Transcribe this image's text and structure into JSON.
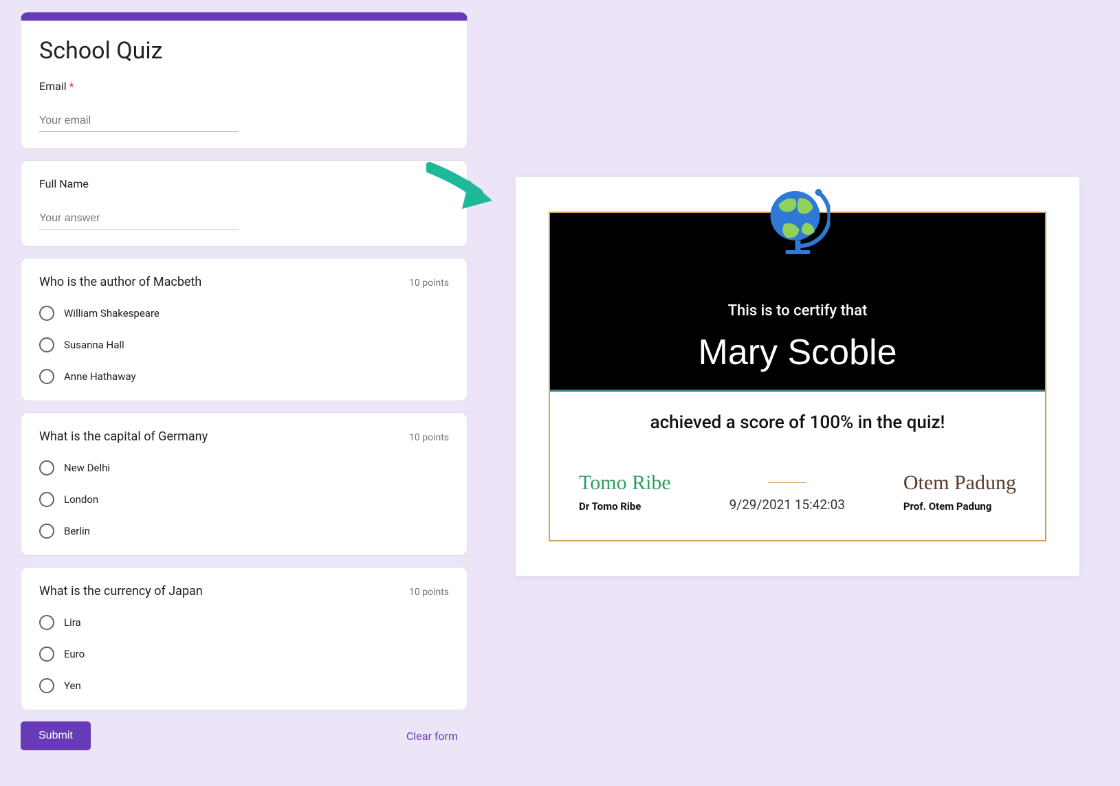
{
  "form": {
    "title": "School Quiz",
    "email_label": "Email",
    "email_required_mark": "*",
    "email_placeholder": "Your email",
    "fullname_label": "Full Name",
    "fullname_placeholder": "Your answer",
    "questions": [
      {
        "title": "Who is the author of Macbeth",
        "points": "10 points",
        "options": [
          "William Shakespeare",
          "Susanna Hall",
          "Anne Hathaway"
        ]
      },
      {
        "title": "What is the capital of Germany",
        "points": "10 points",
        "options": [
          "New Delhi",
          "London",
          "Berlin"
        ]
      },
      {
        "title": "What is the currency of Japan",
        "points": "10 points",
        "options": [
          "Lira",
          "Euro",
          "Yen"
        ]
      }
    ],
    "submit_label": "Submit",
    "clear_label": "Clear form"
  },
  "certificate": {
    "sub": "This is to certify that",
    "name": "Mary Scoble",
    "achievement": "achieved a score of 100% in the quiz!",
    "signer1_sig": "Tomo Ribe",
    "signer1_name": "Dr Tomo Ribe",
    "date": "9/29/2021 15:42:03",
    "signer2_sig": "Otem Padung",
    "signer2_name": "Prof. Otem Padung"
  }
}
